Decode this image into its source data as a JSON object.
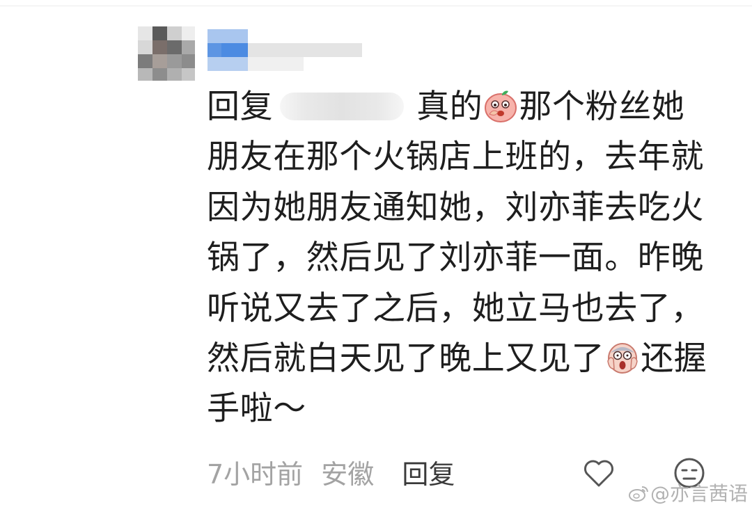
{
  "comment": {
    "lines": [
      [
        "回复",
        "真的",
        "那个粉丝她"
      ],
      "朋友在那个火锅店上班的，去年就",
      "因为她朋友通知她，刘亦菲去吃火",
      "锅了，然后见了刘亦菲一面。昨晚",
      "听说又去了之后，她立马也去了，",
      [
        "然后就白天见了晚上又见了",
        "还握"
      ],
      "手啦～"
    ],
    "emojis": [
      "shy-face-emoji",
      "scream-face-emoji"
    ]
  },
  "footer": {
    "time": "7小时前",
    "location": "安徽",
    "reply": "回复"
  },
  "icons": [
    "like-icon",
    "dislike-face-icon",
    "weibo-logo-icon"
  ],
  "watermark": "@亦言茜语",
  "colors": {
    "text": "#1e1e1e",
    "meta": "#a3a3a3",
    "emoji_pink": "#f4a7a0"
  }
}
